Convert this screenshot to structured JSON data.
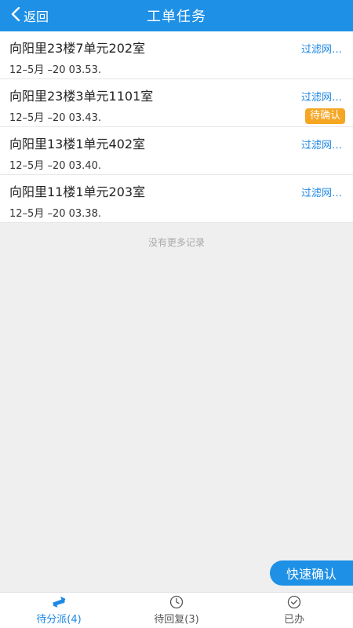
{
  "header": {
    "back_label": "返回",
    "title": "工单任务"
  },
  "orders": [
    {
      "address": "向阳里23楼7单元202室",
      "date": "12–5月 –20 03.53.",
      "type": "过滤网…",
      "status": ""
    },
    {
      "address": "向阳里23楼3单元1101室",
      "date": "12–5月 –20 03.43.",
      "type": "过滤网…",
      "status": "待确认"
    },
    {
      "address": "向阳里13楼1单元402室",
      "date": "12–5月 –20 03.40.",
      "type": "过滤网…",
      "status": ""
    },
    {
      "address": "向阳里11楼1单元203室",
      "date": "12–5月 –20 03.38.",
      "type": "过滤网…",
      "status": ""
    }
  ],
  "no_more_text": "没有更多记录",
  "quick_confirm_label": "快速确认",
  "tabs": [
    {
      "label": "待分派(4)",
      "icon": "swap-arrows-icon",
      "active": true
    },
    {
      "label": "待回复(3)",
      "icon": "clock-icon",
      "active": false
    },
    {
      "label": "已办",
      "icon": "check-circle-icon",
      "active": false
    }
  ],
  "colors": {
    "primary": "#1e90e6",
    "badge": "#f5a623",
    "background": "#efefef"
  }
}
